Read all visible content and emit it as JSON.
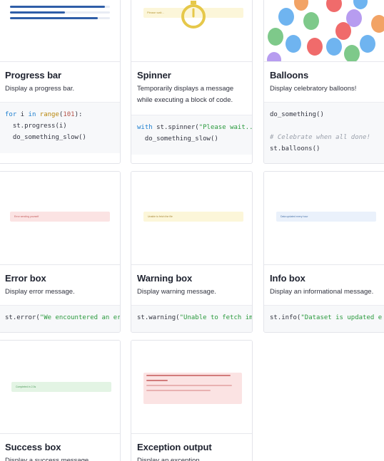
{
  "cards": {
    "progress": {
      "title": "Progress bar",
      "desc": "Display a progress bar.",
      "code": {
        "l1_for": "for",
        "l1_i": " i ",
        "l1_in": "in",
        "l1_range": " range",
        "l1_paren": "(",
        "l1_num": "101",
        "l1_end": "):",
        "l2": "  st.progress(i)",
        "l3": "  do_something_slow()"
      },
      "bars": [
        0.95,
        0.55,
        0.88
      ]
    },
    "spinner": {
      "title": "Spinner",
      "desc": "Temporarily displays a message while executing a block of code.",
      "preview_text": "Please wait...",
      "code": {
        "l1_with": "with",
        "l1_call": " st.spinner(",
        "l1_str": "\"Please wait...",
        "l2": "  do_something_slow()"
      }
    },
    "balloons": {
      "title": "Balloons",
      "desc": "Display celebratory balloons!",
      "code": {
        "l1": "do_something()",
        "l2": "# Celebrate when all done!",
        "l3": "st.balloons()"
      }
    },
    "error": {
      "title": "Error box",
      "desc": "Display error message.",
      "preview_text": "Error sending yourself",
      "code": {
        "call": "st.error(",
        "str": "\"We encountered an er"
      }
    },
    "warning": {
      "title": "Warning box",
      "desc": "Display warning message.",
      "preview_text": "Unable to fetch the file",
      "code": {
        "call": "st.warning(",
        "str": "\"Unable to fetch im"
      }
    },
    "info": {
      "title": "Info box",
      "desc": "Display an informational message.",
      "preview_text": "Data updated every hour",
      "code": {
        "call": "st.info(",
        "str": "\"Dataset is updated e"
      }
    },
    "success": {
      "title": "Success box",
      "desc": "Display a success message.",
      "preview_text": "Completed in 2.3s"
    },
    "exception": {
      "title": "Exception output",
      "desc": "Display an exception."
    }
  },
  "colors": {
    "progress_bar": "#2f5ea8",
    "progress_track": "#e8ecf4",
    "spinner_box": "#fcf6d9",
    "stopwatch": "#e6c84a",
    "error_bg": "#fbe3e3",
    "warning_bg": "#fcf6d9",
    "info_bg": "#eaf1fb",
    "success_bg": "#e3f4e4"
  }
}
